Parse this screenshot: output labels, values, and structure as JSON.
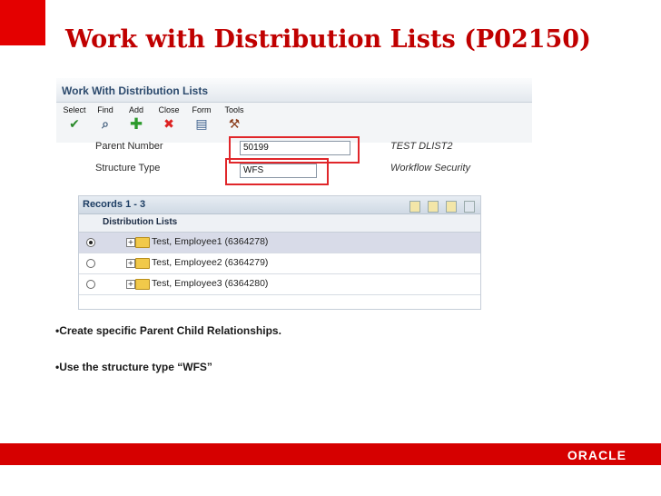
{
  "slide": {
    "title": "Work with Distribution Lists (P02150)",
    "bullets": [
      "•Create specific Parent Child Relationships.",
      "•Use  the structure type  “WFS”"
    ],
    "footer_logo": "ORACLE"
  },
  "app": {
    "window_title": "Work With Distribution Lists",
    "toolbar": [
      {
        "label": "Select",
        "icon": "check-icon"
      },
      {
        "label": "Find",
        "icon": "find-icon"
      },
      {
        "label": "Add",
        "icon": "add-icon"
      },
      {
        "label": "Close",
        "icon": "close-icon"
      },
      {
        "label": "Form",
        "icon": "form-icon"
      },
      {
        "label": "Tools",
        "icon": "tools-icon"
      }
    ],
    "header": {
      "parent_number_label": "Parent Number",
      "parent_number_value": "50199",
      "parent_number_desc": "TEST DLIST2",
      "structure_type_label": "Structure Type",
      "structure_type_value": "WFS",
      "structure_type_desc": "Workflow Security"
    },
    "grid": {
      "records_label": "Records 1 - 3",
      "column_header": "Distribution Lists",
      "rows": [
        {
          "text": "Test, Employee1 (6364278)",
          "selected": true
        },
        {
          "text": "Test, Employee2 (6364279)",
          "selected": false
        },
        {
          "text": "Test, Employee3 (6364280)",
          "selected": false
        }
      ]
    }
  },
  "colors": {
    "title": "#c00000",
    "brand_red": "#d60000",
    "highlight_box": "#e0262a"
  }
}
